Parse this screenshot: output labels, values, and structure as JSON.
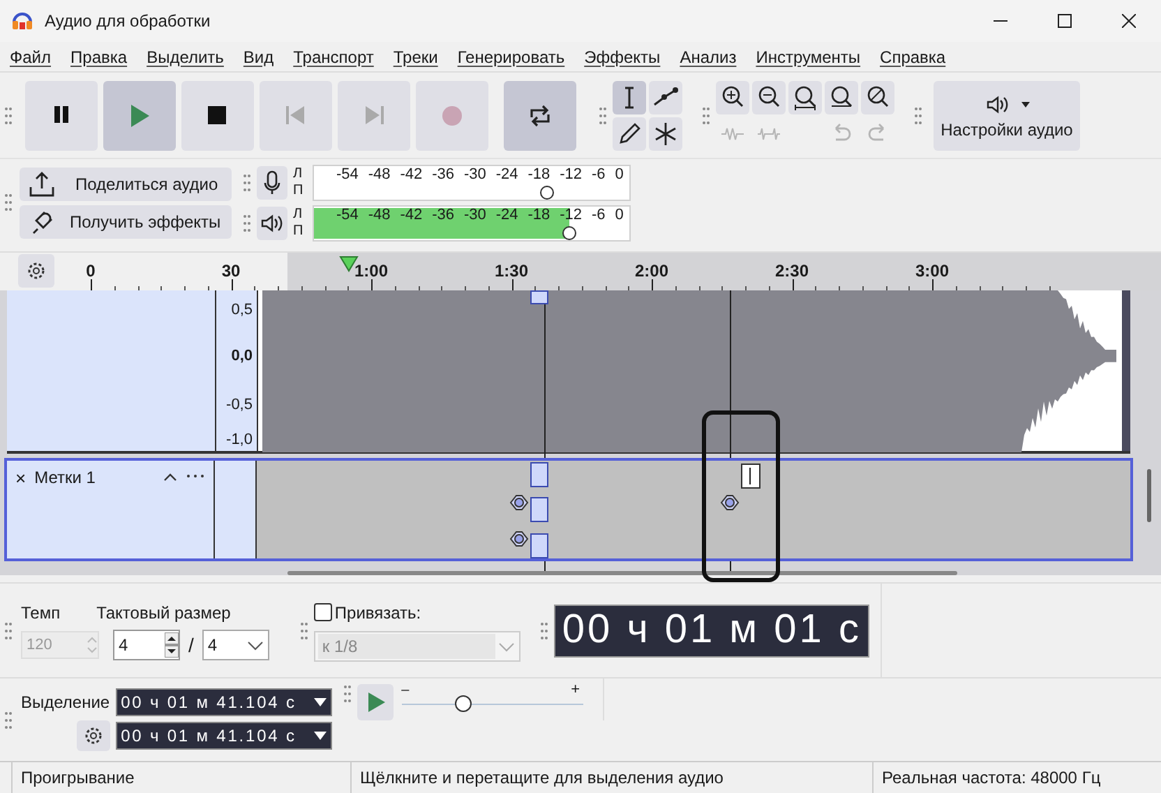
{
  "window": {
    "title": "Аудио для обработки"
  },
  "menu": [
    "Файл",
    "Правка",
    "Выделить",
    "Вид",
    "Транспорт",
    "Треки",
    "Генерировать",
    "Эффекты",
    "Анализ",
    "Инструменты",
    "Справка"
  ],
  "transport": [
    {
      "kind": "pause",
      "disabled": false,
      "selected": false
    },
    {
      "kind": "play",
      "disabled": false,
      "selected": true
    },
    {
      "kind": "stop",
      "disabled": false,
      "selected": false
    },
    {
      "kind": "skip_start",
      "disabled": true,
      "selected": false
    },
    {
      "kind": "skip_end",
      "disabled": true,
      "selected": false
    },
    {
      "kind": "record",
      "disabled": true,
      "selected": false
    },
    {
      "kind": "loop",
      "disabled": false,
      "selected": true
    }
  ],
  "tools": [
    {
      "kind": "select",
      "selected": true
    },
    {
      "kind": "envelope",
      "selected": false
    },
    {
      "kind": "draw",
      "selected": false
    },
    {
      "kind": "multi",
      "selected": false
    }
  ],
  "edit_tools": [
    {
      "kind": "zoom_in",
      "disabled": false
    },
    {
      "kind": "zoom_out",
      "disabled": false
    },
    {
      "kind": "fit_selection",
      "disabled": false
    },
    {
      "kind": "fit_project",
      "disabled": false
    },
    {
      "kind": "zoom_toggle",
      "disabled": false
    },
    {
      "kind": "trim",
      "disabled": true
    },
    {
      "kind": "silence",
      "disabled": true
    },
    {
      "kind": "gap"
    },
    {
      "kind": "undo",
      "disabled": true
    },
    {
      "kind": "redo",
      "disabled": true
    }
  ],
  "audio_setup": {
    "label": "Настройки аудио"
  },
  "share_button": {
    "label": "Поделиться аудио"
  },
  "effects_button": {
    "label": "Получить эффекты"
  },
  "meters": [
    {
      "kind": "record",
      "channels": [
        "Л",
        "П"
      ],
      "ticks": [
        "-54",
        "-48",
        "-42",
        "-36",
        "-30",
        "-24",
        "-18",
        "-12",
        "-6",
        "0"
      ],
      "level": 0.74
    },
    {
      "kind": "playback",
      "channels": [
        "Л",
        "П"
      ],
      "ticks": [
        "-54",
        "-48",
        "-42",
        "-36",
        "-30",
        "-24",
        "-18",
        "-12",
        "-6",
        "0"
      ],
      "signal": {
        "level": 0.81
      },
      "level": 0.81
    }
  ],
  "ruler": {
    "ticks": [
      "0",
      "30",
      "1:00",
      "1:30",
      "2:00",
      "2:30",
      "3:00"
    ]
  },
  "audio_track": {
    "scale": [
      "0,5",
      "0,0",
      "-0,5",
      "-1,0"
    ]
  },
  "label_track": {
    "close": "×",
    "name": "Метки 1"
  },
  "time_signature": {
    "tempo_label": "Темп",
    "tempo": "120",
    "tempo_disabled": true,
    "signature_label": "Тактовый размер",
    "upper": "4",
    "separator": "/",
    "lower": "4"
  },
  "snap": {
    "label": "Привязать:",
    "checked": false,
    "value": "к 1/8",
    "disabled": true
  },
  "time": {
    "value": "00 ч 01 м 01 с"
  },
  "selection": {
    "label": "Выделение",
    "start": "00 ч 01 м 41.104 с",
    "end": "00 ч 01 м 41.104 с"
  },
  "play_at_speed": {
    "min": "–",
    "max": "+",
    "level": 0.34
  },
  "status_bar": [
    "Проигрывание",
    "Щёлкните и перетащите для выделения аудио",
    "Реальная частота: 48000 Гц"
  ]
}
